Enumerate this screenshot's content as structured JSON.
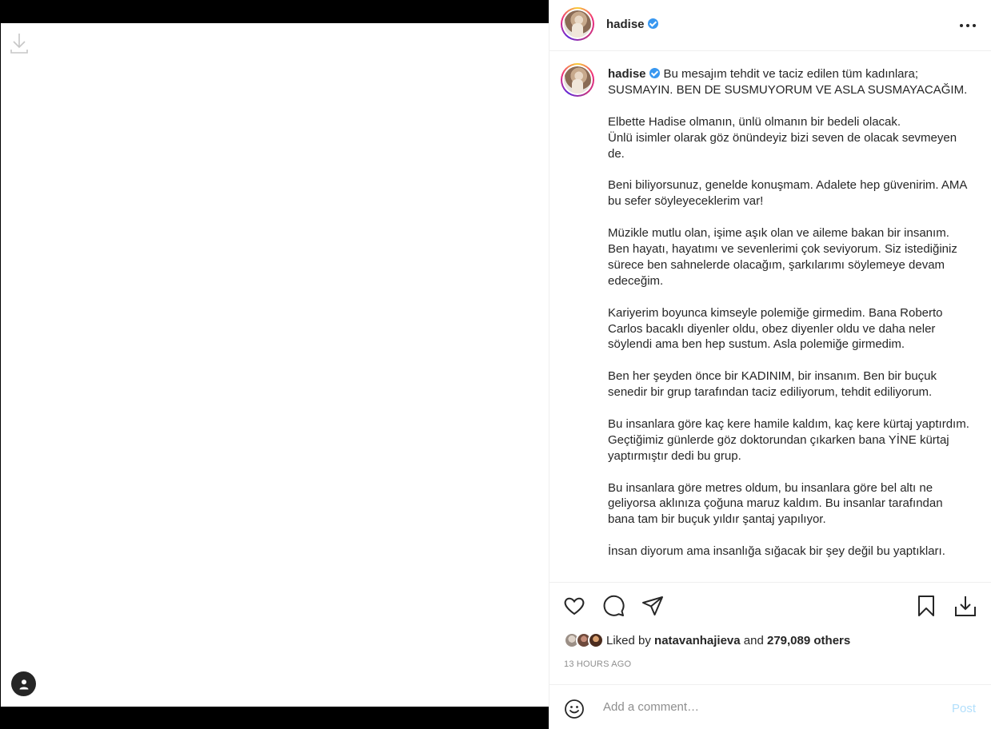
{
  "post": {
    "username": "hadise",
    "verified": true,
    "caption": "Bu mesajım tehdit ve taciz edilen tüm kadınlara;\nSUSMAYIN. BEN DE SUSMUYORUM VE ASLA SUSMAYACAĞIM.\n\nElbette Hadise olmanın, ünlü olmanın bir bedeli olacak.\nÜnlü isimler olarak göz önündeyiz bizi seven de olacak sevmeyen de.\n\nBeni biliyorsunuz, genelde konuşmam. Adalete hep güvenirim. AMA bu sefer söyleyeceklerim var!\n\nMüzikle mutlu olan, işime aşık olan ve aileme bakan bir insanım. Ben hayatı, hayatımı ve sevenlerimi çok seviyorum. Siz istediğiniz sürece ben sahnelerde olacağım, şarkılarımı söylemeye devam edeceğim.\n\nKariyerim boyunca kimseyle polemiğe girmedim. Bana Roberto Carlos bacaklı diyenler oldu, obez diyenler oldu ve daha neler söylendi ama ben hep sustum. Asla polemiğe girmedim.\n\nBen her şeyden önce bir KADINIM, bir insanım. Ben bir buçuk senedir bir grup tarafından taciz ediliyorum, tehdit ediliyorum.\n\nBu insanlara göre kaç kere hamile kaldım, kaç kere kürtaj yaptırdım. Geçtiğimiz günlerde göz doktorundan çıkarken bana YİNE kürtaj yaptırmıştır dedi bu grup.\n\nBu insanlara göre metres oldum, bu insanlara göre bel altı ne geliyorsa aklınıza çoğuna maruz kaldım. Bu insanlar tarafından bana tam bir buçuk yıldır şantaj yapılıyor.\n\nİnsan diyorum ama insanlığa sığacak bir şey değil bu yaptıkları.",
    "liked_by_user": "natavanhajieva",
    "liked_by_prefix": "Liked by",
    "liked_by_and": "and",
    "likes_others": "279,089 others",
    "timestamp": "13 HOURS AGO"
  },
  "comment": {
    "placeholder": "Add a comment…",
    "post_label": "Post"
  },
  "colors": {
    "verified_blue": "#3897f0",
    "post_button_disabled": "#b2dffc",
    "secondary_text": "#8e8e8e"
  }
}
